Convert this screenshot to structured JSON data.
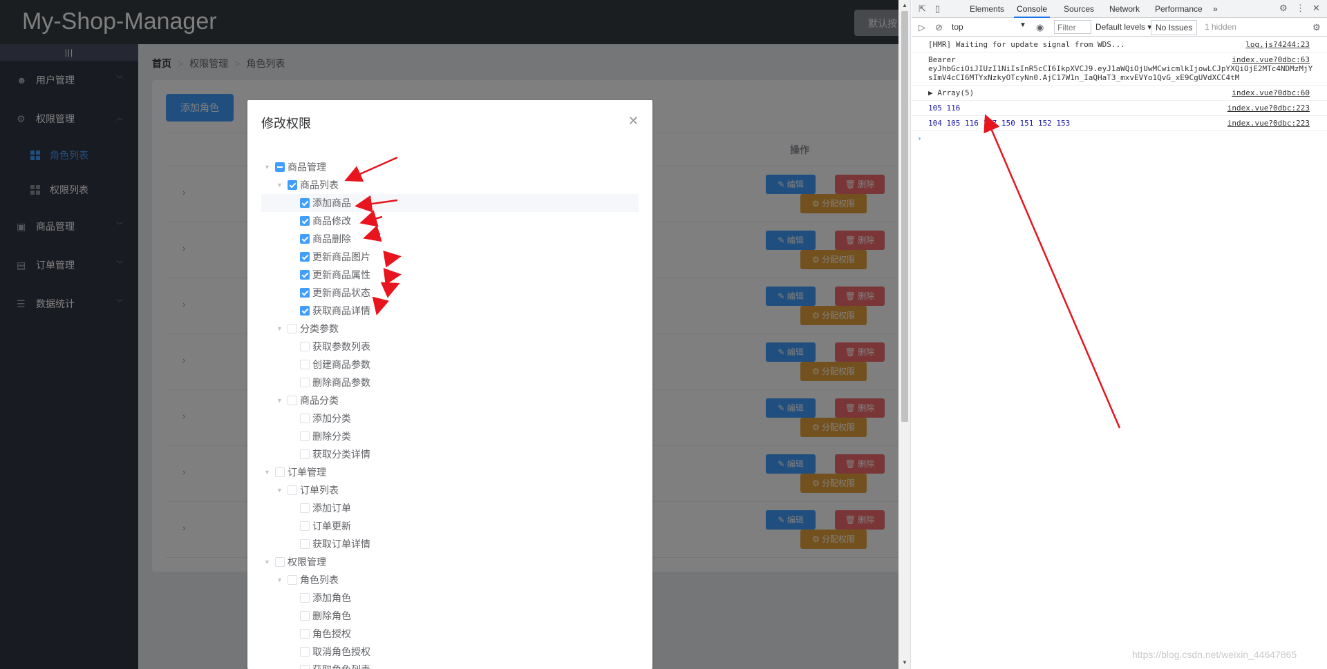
{
  "header": {
    "title": "My-Shop-Manager",
    "logout_label": "默认按"
  },
  "sidebar": {
    "toggle": "|||",
    "items": [
      {
        "label": "用户管理",
        "icon": "user-icon",
        "arrow": "﹀"
      },
      {
        "label": "权限管理",
        "icon": "gear-icon",
        "arrow": "︿"
      },
      {
        "label": "商品管理",
        "icon": "shopping-bag-icon",
        "arrow": "﹀"
      },
      {
        "label": "订单管理",
        "icon": "cart-icon",
        "arrow": "﹀"
      },
      {
        "label": "数据统计",
        "icon": "sliders-icon",
        "arrow": "﹀"
      }
    ],
    "subitems": [
      {
        "label": "角色列表",
        "active": true
      },
      {
        "label": "权限列表",
        "active": false
      }
    ]
  },
  "breadcrumb": [
    "首页",
    "权限管理",
    "角色列表"
  ],
  "main": {
    "add_role_label": "添加角色",
    "table_op_header": "操作",
    "row_expand_glyph": "›",
    "row_buttons": {
      "edit": "✎ 编辑",
      "delete": "🗑 删除",
      "assign": "⚙ 分配权限"
    },
    "row_count": 7
  },
  "dialog": {
    "title": "修改权限",
    "close_glyph": "✕",
    "tree": [
      {
        "label": "商品管理",
        "level": 0,
        "state": "half",
        "expanded": true
      },
      {
        "label": "商品列表",
        "level": 1,
        "state": "checked",
        "expanded": true
      },
      {
        "label": "添加商品",
        "level": 2,
        "state": "checked",
        "hl": true
      },
      {
        "label": "商品修改",
        "level": 2,
        "state": "checked"
      },
      {
        "label": "商品删除",
        "level": 2,
        "state": "checked"
      },
      {
        "label": "更新商品图片",
        "level": 2,
        "state": "checked"
      },
      {
        "label": "更新商品属性",
        "level": 2,
        "state": "checked"
      },
      {
        "label": "更新商品状态",
        "level": 2,
        "state": "checked"
      },
      {
        "label": "获取商品详情",
        "level": 2,
        "state": "checked"
      },
      {
        "label": "分类参数",
        "level": 1,
        "state": "none",
        "expanded": true
      },
      {
        "label": "获取参数列表",
        "level": 2,
        "state": "none"
      },
      {
        "label": "创建商品参数",
        "level": 2,
        "state": "none"
      },
      {
        "label": "删除商品参数",
        "level": 2,
        "state": "none"
      },
      {
        "label": "商品分类",
        "level": 1,
        "state": "none",
        "expanded": true
      },
      {
        "label": "添加分类",
        "level": 2,
        "state": "none"
      },
      {
        "label": "删除分类",
        "level": 2,
        "state": "none"
      },
      {
        "label": "获取分类详情",
        "level": 2,
        "state": "none"
      },
      {
        "label": "订单管理",
        "level": 0,
        "state": "none",
        "expanded": true
      },
      {
        "label": "订单列表",
        "level": 1,
        "state": "none",
        "expanded": true
      },
      {
        "label": "添加订单",
        "level": 2,
        "state": "none"
      },
      {
        "label": "订单更新",
        "level": 2,
        "state": "none"
      },
      {
        "label": "获取订单详情",
        "level": 2,
        "state": "none"
      },
      {
        "label": "权限管理",
        "level": 0,
        "state": "none",
        "expanded": true
      },
      {
        "label": "角色列表",
        "level": 1,
        "state": "none",
        "expanded": true
      },
      {
        "label": "添加角色",
        "level": 2,
        "state": "none"
      },
      {
        "label": "删除角色",
        "level": 2,
        "state": "none"
      },
      {
        "label": "角色授权",
        "level": 2,
        "state": "none"
      },
      {
        "label": "取消角色授权",
        "level": 2,
        "state": "none"
      },
      {
        "label": "获取角色列表",
        "level": 2,
        "state": "none"
      }
    ]
  },
  "devtools": {
    "tabs": [
      "Elements",
      "Console",
      "Sources",
      "Network",
      "Performance",
      "»"
    ],
    "active_tab": "Console",
    "toolbar": {
      "context": "top",
      "filter_placeholder": "Filter",
      "levels": "Default levels ▾",
      "issues": "No Issues",
      "hidden": "1 hidden"
    },
    "lines": [
      {
        "msg": "[HMR] Waiting for update signal from WDS...",
        "src": "log.js?4244:23",
        "color": "default"
      },
      {
        "msg": "Bearer\neyJhbGciOiJIUzI1NiIsInR5cCI6IkpXVCJ9.eyJ1aWQiOjUwMCwicmlkIjowLCJpYXQiOjE2MTc4NDMzMjY\nsImV4cCI6MTYxNzkyOTcyNn0.AjC17W1n_IaQHaT3_mxvEVYo1QvG_xE9CgUVdXCC4tM",
        "src": "index.vue?0dbc:63",
        "color": "default"
      },
      {
        "msg": "▶ Array(5)",
        "src": "index.vue?0dbc:60",
        "color": "default"
      },
      {
        "msg": "105 116",
        "src": "index.vue?0dbc:223",
        "color": "blue"
      },
      {
        "msg": "104 105 116 117 150 151 152 153",
        "src": "index.vue?0dbc:223",
        "color": "blue"
      }
    ],
    "prompt": "›"
  },
  "watermark": "https://blog.csdn.net/weixin_44647865",
  "colors": {
    "primary": "#409eff",
    "danger": "#f56c6c",
    "warning": "#e6a23c",
    "annotation": "#e8141e"
  }
}
